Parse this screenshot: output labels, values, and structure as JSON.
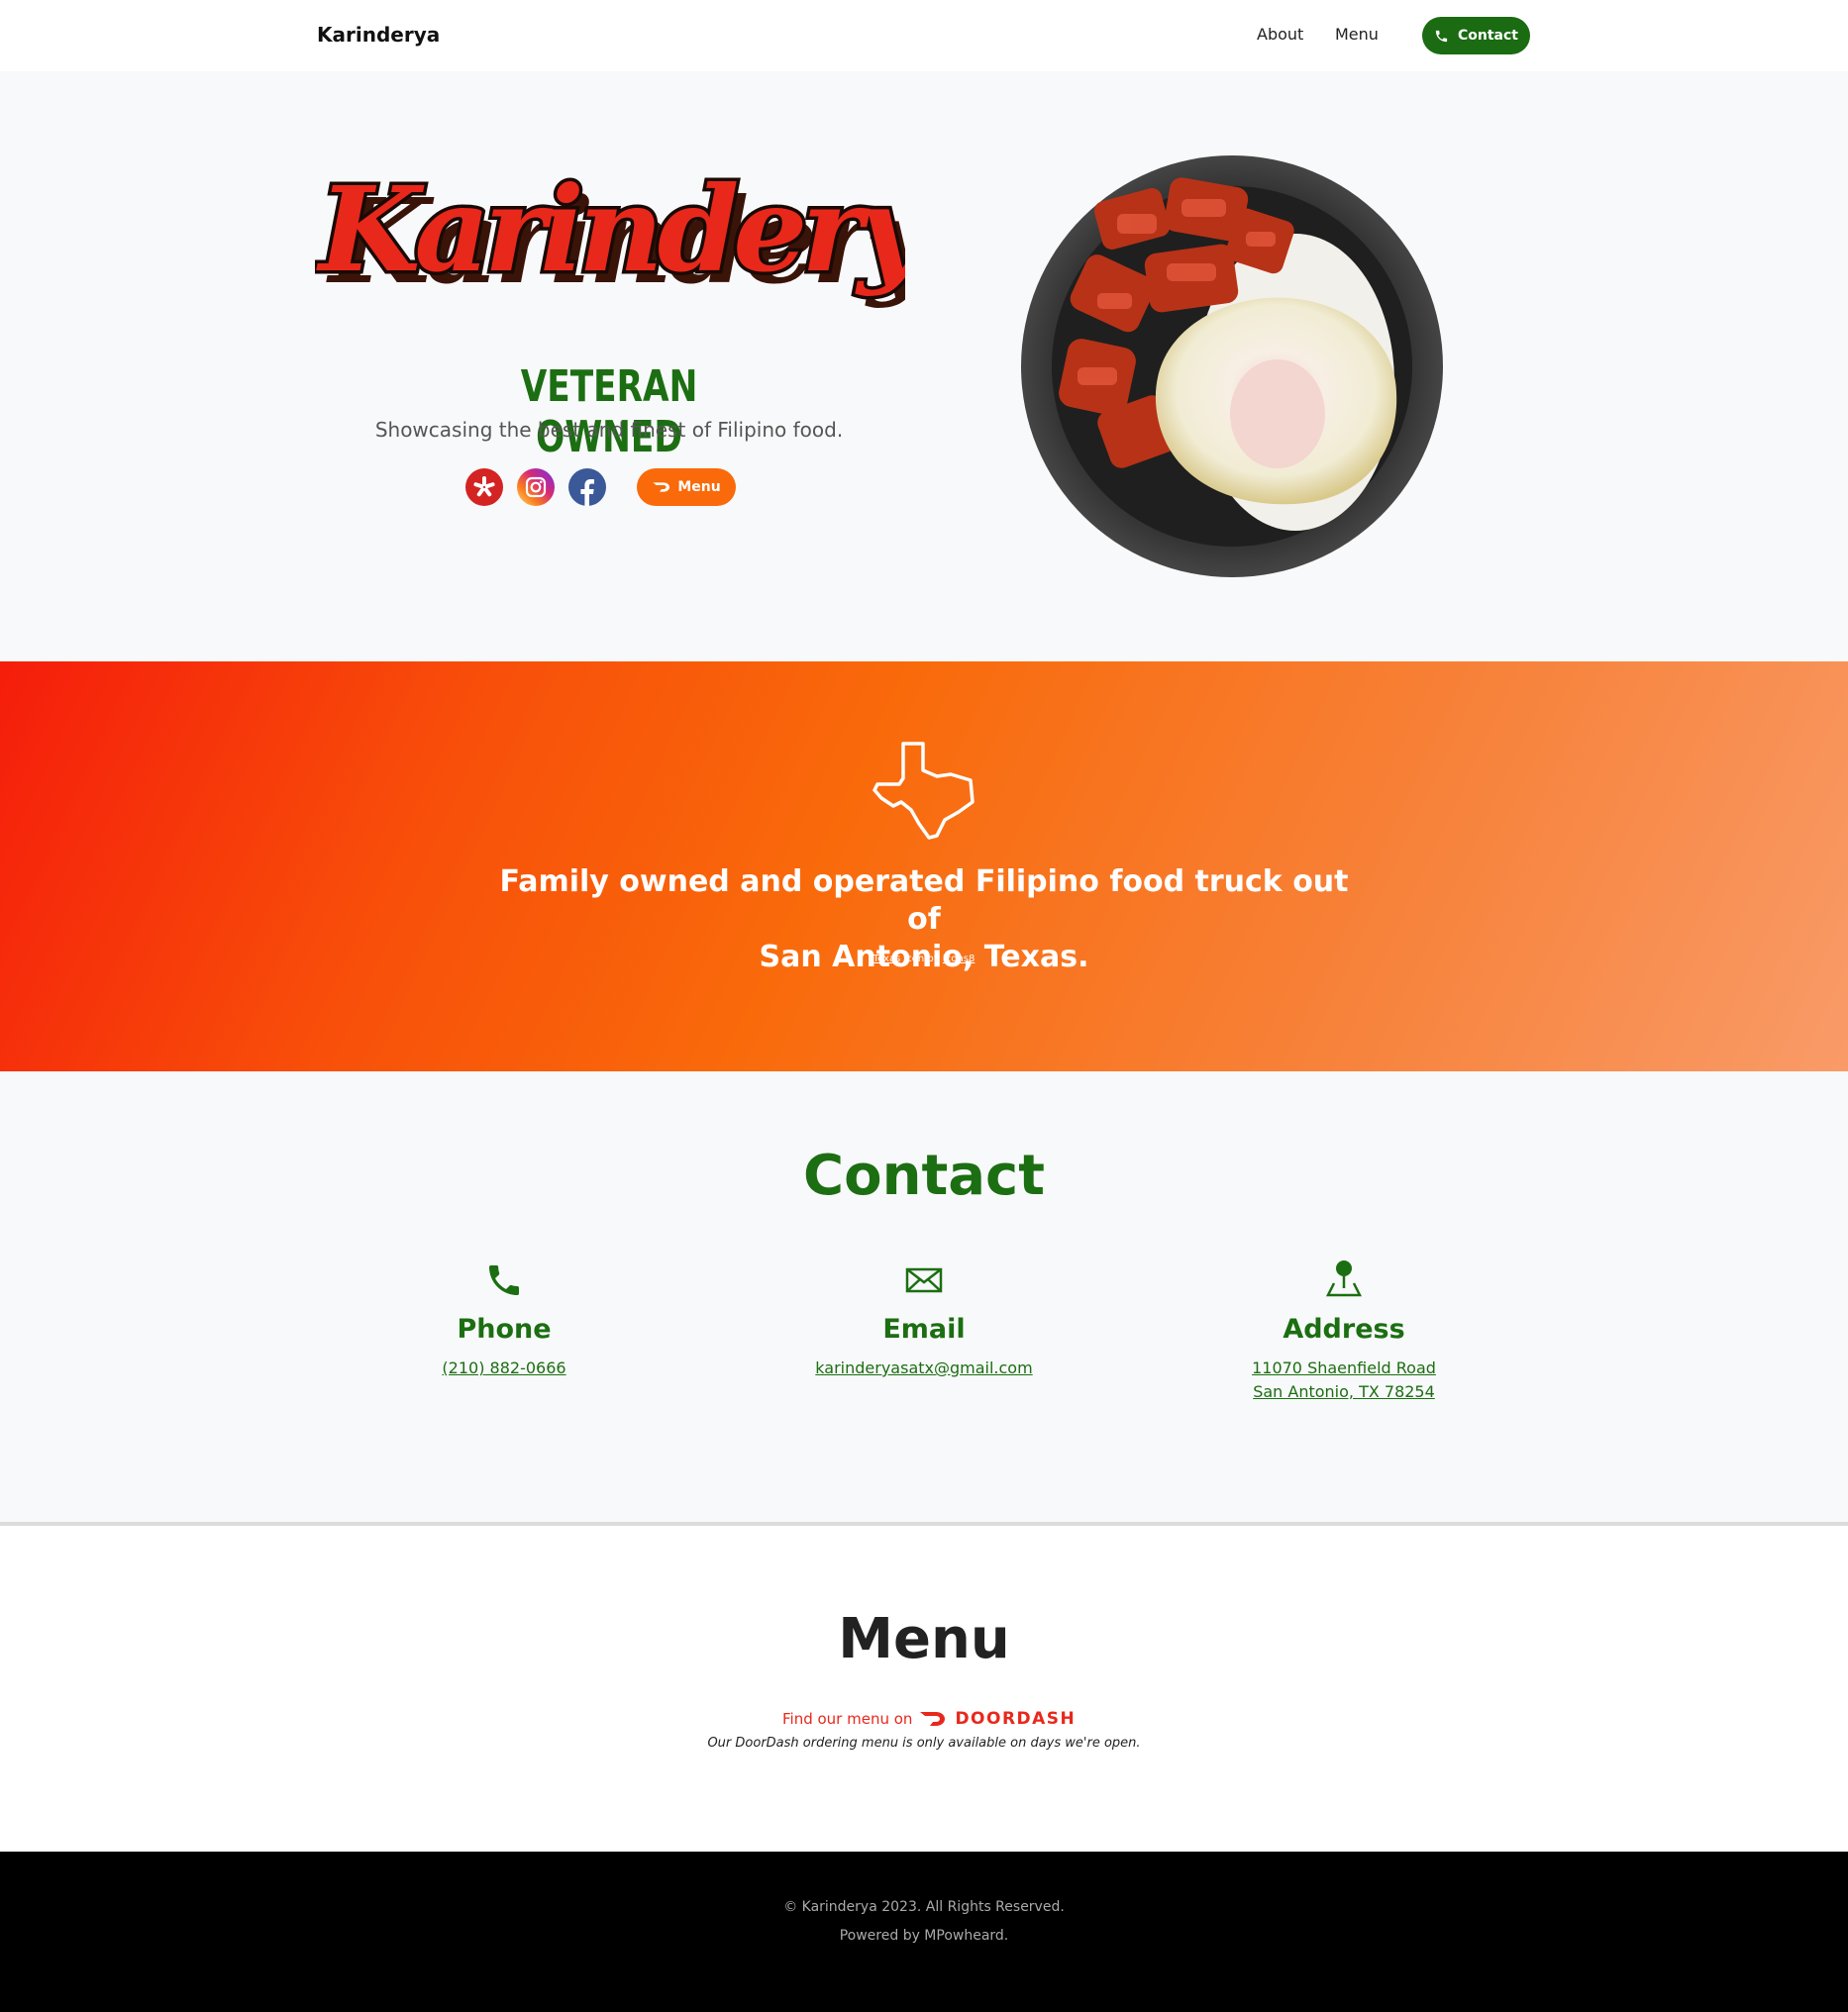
{
  "navbar": {
    "brand": "Karinderya",
    "links": [
      "About",
      "Menu"
    ],
    "contact_label": "Contact"
  },
  "hero": {
    "logo_text": "Karinderya",
    "subtitle": "VETERAN OWNED",
    "tagline": "Showcasing the best and finest of Filipino food.",
    "social_icons": [
      "yelp-icon",
      "instagram-icon",
      "facebook-icon"
    ],
    "menu_button_label": "Menu"
  },
  "banner": {
    "text_line1": "Family owned and operated Filipino food truck out of",
    "text_line2": "San Antonio, Texas.",
    "credit_link1": "Texas",
    "credit_middle": " icon by ",
    "credit_link2": "Icons8"
  },
  "contact": {
    "title": "Contact",
    "phone": {
      "heading": "Phone",
      "value": "(210) 882-0666"
    },
    "email": {
      "heading": "Email",
      "value": "karinderyasatx@gmail.com"
    },
    "address": {
      "heading": "Address",
      "line1": "11070 Shaenfield Road",
      "line2": "San Antonio, TX 78254"
    }
  },
  "menu": {
    "title": "Menu",
    "find_text": "Find our menu on",
    "doordash_label": "DOORDASH",
    "note": "Our DoorDash ordering menu is only available on days we're open."
  },
  "footer": {
    "copyright": "© Karinderya 2023. All Rights Reserved.",
    "powered": "Powered by MPowheard."
  },
  "colors": {
    "brand_green": "#1c6e12",
    "brand_orange": "#fa6a0a",
    "brand_red": "#e8281b"
  }
}
